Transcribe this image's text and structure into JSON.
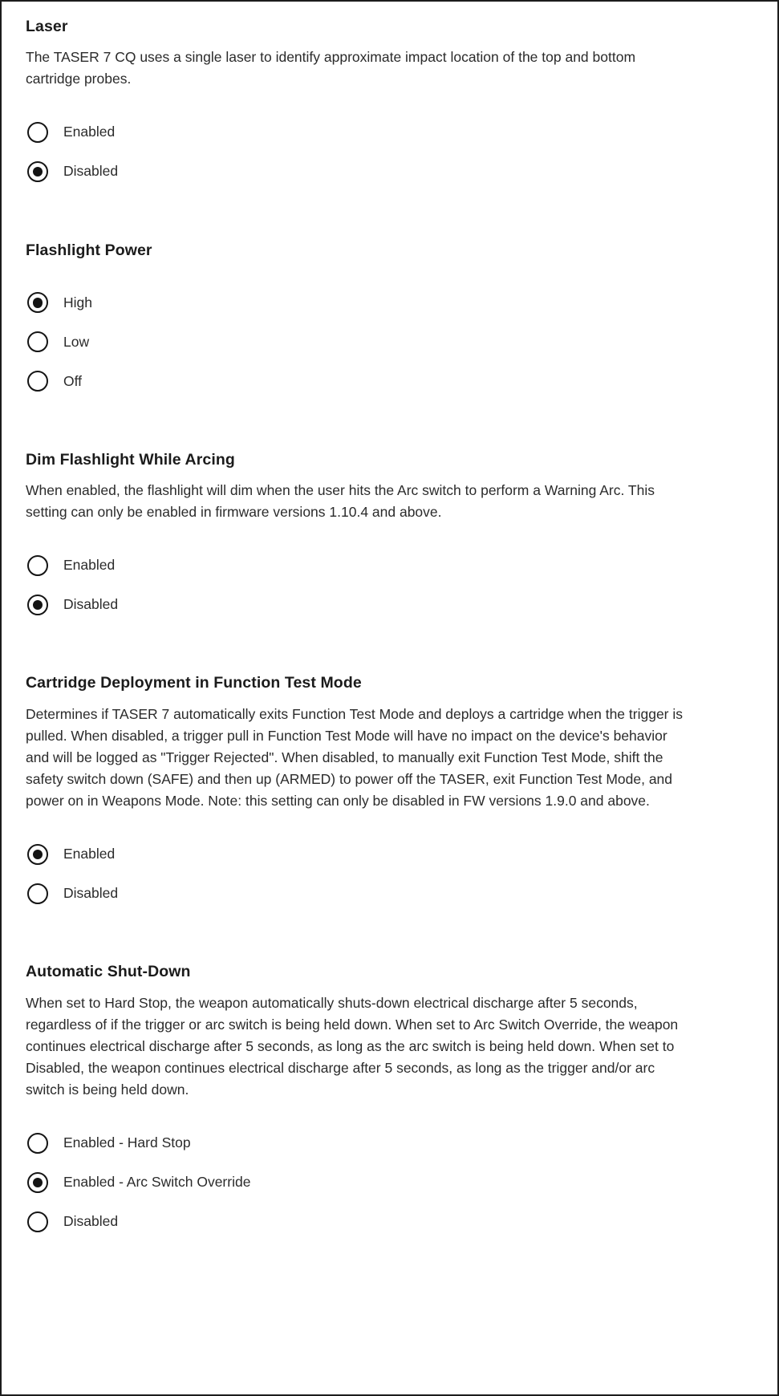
{
  "page": {
    "background_color": "#ffffff",
    "border_color": "#1d1d1d",
    "text_color": "#2b2b2b",
    "heading_color": "#1b1b1b",
    "radio_color": "#141414"
  },
  "sections": [
    {
      "id": "laser",
      "title": "Laser",
      "description": "The TASER 7 CQ uses a single laser to identify approximate impact location of the top and bottom cartridge probes.",
      "options": [
        {
          "label": "Enabled",
          "selected": false
        },
        {
          "label": "Disabled",
          "selected": true
        }
      ]
    },
    {
      "id": "flashlight-power",
      "title": "Flashlight Power",
      "description": "",
      "options": [
        {
          "label": "High",
          "selected": true
        },
        {
          "label": "Low",
          "selected": false
        },
        {
          "label": "Off",
          "selected": false
        }
      ]
    },
    {
      "id": "dim-flashlight-while-arcing",
      "title": "Dim Flashlight While Arcing",
      "description": "When enabled, the flashlight will dim when the user hits the Arc switch to perform a Warning Arc. This setting can only be enabled in firmware versions 1.10.4 and above.",
      "options": [
        {
          "label": "Enabled",
          "selected": false
        },
        {
          "label": "Disabled",
          "selected": true
        }
      ]
    },
    {
      "id": "cartridge-deployment-in-function-test-mode",
      "title": "Cartridge Deployment in Function Test Mode",
      "description": "Determines if TASER 7 automatically exits Function Test Mode and deploys a cartridge when the trigger is pulled. When disabled, a trigger pull in Function Test Mode will have no impact on the device's behavior and will be logged as \"Trigger Rejected\". When disabled, to manually exit Function Test Mode, shift the safety switch down (SAFE) and then up (ARMED) to power off the TASER, exit Function Test Mode, and power on in Weapons Mode. Note: this setting can only be disabled in FW versions 1.9.0 and above.",
      "options": [
        {
          "label": "Enabled",
          "selected": true
        },
        {
          "label": "Disabled",
          "selected": false
        }
      ]
    },
    {
      "id": "automatic-shut-down",
      "title": "Automatic Shut-Down",
      "description": "When set to Hard Stop, the weapon automatically shuts-down electrical discharge after 5 seconds, regardless of if the trigger or arc switch is being held down. When set to Arc Switch Override, the weapon continues electrical discharge after 5 seconds, as long as the arc switch is being held down. When set to Disabled, the weapon continues electrical discharge after 5 seconds, as long as the trigger and/or arc switch is being held down.",
      "options": [
        {
          "label": "Enabled - Hard Stop",
          "selected": false
        },
        {
          "label": "Enabled - Arc Switch Override",
          "selected": true
        },
        {
          "label": "Disabled",
          "selected": false
        }
      ]
    }
  ]
}
